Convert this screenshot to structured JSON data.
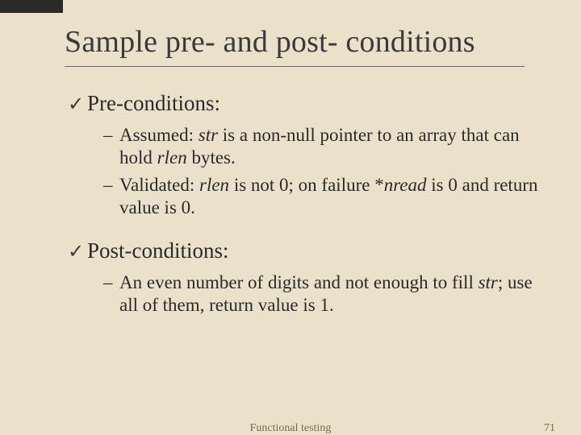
{
  "title": "Sample pre- and post- conditions",
  "sections": [
    {
      "heading": "Pre-conditions:",
      "items": [
        "Assumed: <i>str</i> is a non-null pointer to an array that can hold <i>rlen</i> bytes.",
        "Validated: <i>rlen</i> is not 0; on failure *<i>nread</i> is 0 and return value is 0."
      ]
    },
    {
      "heading": "Post-conditions:",
      "items": [
        "An even number of digits and not enough to fill <i>str</i>; use all of them, return value is 1."
      ]
    }
  ],
  "footer": {
    "center": "Functional testing",
    "page": "71"
  }
}
